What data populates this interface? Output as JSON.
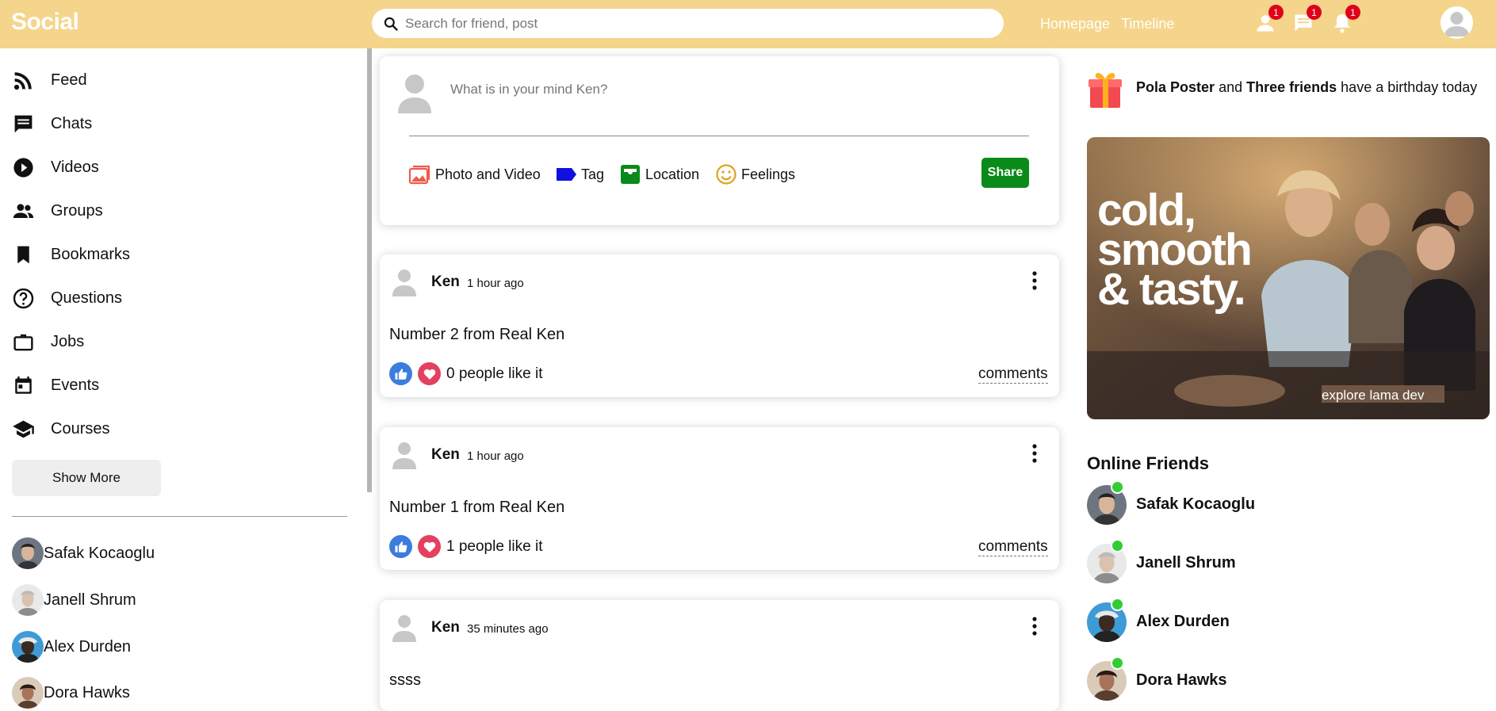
{
  "topbar": {
    "logo": "Social",
    "search_placeholder": "Search for friend, post",
    "links": [
      "Homepage",
      "Timeline"
    ],
    "badges": {
      "friends": "1",
      "messages": "1",
      "notifications": "1"
    },
    "color": "#f5d48b"
  },
  "sidebar": {
    "items": [
      {
        "label": "Feed",
        "icon": "rss-feed-icon"
      },
      {
        "label": "Chats",
        "icon": "chat-icon"
      },
      {
        "label": "Videos",
        "icon": "play-circle-icon"
      },
      {
        "label": "Groups",
        "icon": "group-icon"
      },
      {
        "label": "Bookmarks",
        "icon": "bookmark-icon"
      },
      {
        "label": "Questions",
        "icon": "help-icon"
      },
      {
        "label": "Jobs",
        "icon": "briefcase-icon"
      },
      {
        "label": "Events",
        "icon": "calendar-icon"
      },
      {
        "label": "Courses",
        "icon": "school-icon"
      }
    ],
    "show_more": "Show More",
    "friends": [
      "Safak Kocaoglu",
      "Janell Shrum",
      "Alex Durden",
      "Dora Hawks"
    ]
  },
  "share": {
    "placeholder": "What is in your mind Ken?",
    "options": [
      "Photo and Video",
      "Tag",
      "Location",
      "Feelings"
    ],
    "button": "Share",
    "button_color": "#0a8a18"
  },
  "posts": [
    {
      "user": "Ken",
      "time": "1 hour ago",
      "text": "Number 2 from Real Ken",
      "likes": "0 people like it",
      "comments": "comments"
    },
    {
      "user": "Ken",
      "time": "1 hour ago",
      "text": "Number 1 from Real Ken",
      "likes": "1 people like it",
      "comments": "comments"
    },
    {
      "user": "Ken",
      "time": "35 minutes ago",
      "text": "ssss"
    }
  ],
  "rightbar": {
    "birthday": {
      "name1": "Pola Poster",
      "and": "and",
      "name2": "Three friends",
      "suffix": "have a birthday today"
    },
    "ad": {
      "headline_line1": "cold,",
      "headline_line2": "smooth",
      "headline_line3": "& tasty.",
      "tagline": "explore lama dev"
    },
    "online_title": "Online Friends",
    "online": [
      "Safak Kocaoglu",
      "Janell Shrum",
      "Alex Durden",
      "Dora Hawks"
    ],
    "online_color": "#32cd32"
  }
}
